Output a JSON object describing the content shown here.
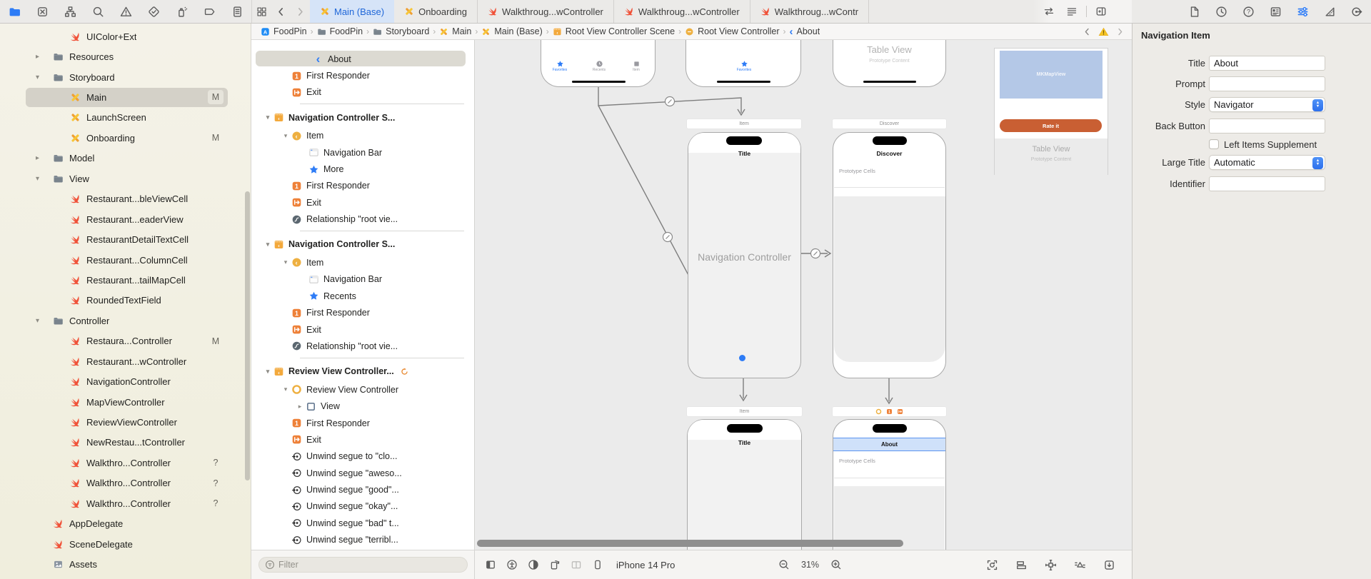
{
  "colors": {
    "accent_blue": "#2e7cf6",
    "selected_tab_bg": "#d6e4f8",
    "swift_orange": "#f05138",
    "storyboard_gold": "#eeb041",
    "scene_orange": "#ee8139",
    "rate_button": "#c95f33",
    "map_blue": "#b4c8e7",
    "nav_selected_blue": "#cfe1fa"
  },
  "toolbar": {
    "navigator_icons": [
      "project-navigator-icon",
      "source-control-icon",
      "symbols-icon",
      "search-icon",
      "issues-icon",
      "tests-icon",
      "debug-icon",
      "breakpoints-icon",
      "reports-icon"
    ],
    "navigator_active_index": 0,
    "tab_overview_icon": "tab-overview-icon",
    "back_label": "back",
    "forward_label": "forward",
    "tabs": [
      {
        "icon": "storyboard",
        "label": "Main (Base)",
        "active": true
      },
      {
        "icon": "storyboard",
        "label": "Onboarding",
        "active": false
      },
      {
        "icon": "swift",
        "label": "Walkthroug...wController",
        "active": false
      },
      {
        "icon": "swift",
        "label": "Walkthroug...wController",
        "active": false
      },
      {
        "icon": "swift",
        "label": "Walkthroug...wContr",
        "active": false
      }
    ],
    "editor_buttons": [
      "code-review-icon",
      "editor-options-icon",
      "add-editor-icon"
    ],
    "inspector_icons": [
      "file-inspector-icon",
      "history-inspector-icon",
      "help-inspector-icon",
      "quick-help-inspector-icon",
      "attributes-inspector-icon",
      "size-inspector-icon",
      "connections-inspector-icon"
    ],
    "inspector_active_index": 4
  },
  "jumpbar": {
    "items": [
      {
        "icon": "appicon",
        "label": "FoodPin"
      },
      {
        "icon": "folder",
        "label": "FoodPin"
      },
      {
        "icon": "folder",
        "label": "Storyboard"
      },
      {
        "icon": "storyboard",
        "label": "Main"
      },
      {
        "icon": "storyboard",
        "label": "Main (Base)"
      },
      {
        "icon": "scene",
        "label": "Root View Controller Scene"
      },
      {
        "icon": "vc-circle",
        "label": "Root View Controller"
      },
      {
        "icon": "back-blue",
        "label": "About"
      }
    ],
    "warning_icon": "warning-icon"
  },
  "sidebar": {
    "items": [
      {
        "indent": 1,
        "icon": "swift",
        "label": "UIColor+Ext"
      },
      {
        "indent": 0,
        "icon": "folder",
        "label": "Resources",
        "disclosure": "closed"
      },
      {
        "indent": 0,
        "icon": "folder",
        "label": "Storyboard",
        "disclosure": "open"
      },
      {
        "indent": 1,
        "icon": "storyboard",
        "label": "Main",
        "badge": "M",
        "selected": true
      },
      {
        "indent": 1,
        "icon": "storyboard",
        "label": "LaunchScreen"
      },
      {
        "indent": 1,
        "icon": "storyboard",
        "label": "Onboarding",
        "badge": "M"
      },
      {
        "indent": 0,
        "icon": "folder",
        "label": "Model",
        "disclosure": "closed"
      },
      {
        "indent": 0,
        "icon": "folder",
        "label": "View",
        "disclosure": "open"
      },
      {
        "indent": 1,
        "icon": "swift",
        "label": "Restaurant...bleViewCell"
      },
      {
        "indent": 1,
        "icon": "swift",
        "label": "Restaurant...eaderView"
      },
      {
        "indent": 1,
        "icon": "swift",
        "label": "RestaurantDetailTextCell"
      },
      {
        "indent": 1,
        "icon": "swift",
        "label": "Restaurant...ColumnCell"
      },
      {
        "indent": 1,
        "icon": "swift",
        "label": "Restaurant...tailMapCell"
      },
      {
        "indent": 1,
        "icon": "swift",
        "label": "RoundedTextField"
      },
      {
        "indent": 0,
        "icon": "folder",
        "label": "Controller",
        "disclosure": "open"
      },
      {
        "indent": 1,
        "icon": "swift",
        "label": "Restaura...Controller",
        "badge": "M"
      },
      {
        "indent": 1,
        "icon": "swift",
        "label": "Restaurant...wController"
      },
      {
        "indent": 1,
        "icon": "swift",
        "label": "NavigationController"
      },
      {
        "indent": 1,
        "icon": "swift",
        "label": "MapViewController"
      },
      {
        "indent": 1,
        "icon": "swift",
        "label": "ReviewViewController"
      },
      {
        "indent": 1,
        "icon": "swift",
        "label": "NewRestau...tController"
      },
      {
        "indent": 1,
        "icon": "swift",
        "label": "Walkthro...Controller",
        "badge": "?"
      },
      {
        "indent": 1,
        "icon": "swift",
        "label": "Walkthro...Controller",
        "badge": "?"
      },
      {
        "indent": 1,
        "icon": "swift",
        "label": "Walkthro...Controller",
        "badge": "?"
      },
      {
        "indent": 0,
        "icon": "swift",
        "label": "AppDelegate"
      },
      {
        "indent": 0,
        "icon": "swift",
        "label": "SceneDelegate"
      },
      {
        "indent": 0,
        "icon": "assets",
        "label": "Assets"
      }
    ]
  },
  "outline": {
    "rows": [
      {
        "type": "row",
        "ind": 71,
        "icon": "back-blue",
        "label": "About",
        "selected": true
      },
      {
        "type": "row",
        "ind": 41,
        "icon": "first-responder",
        "label": "First Responder"
      },
      {
        "type": "row",
        "ind": 41,
        "icon": "exit",
        "label": "Exit"
      },
      {
        "type": "sep"
      },
      {
        "type": "scene",
        "ind": 16,
        "icon": "scene",
        "label": "Navigation Controller S...",
        "disclosure": "open"
      },
      {
        "type": "row",
        "ind": 41,
        "icon": "item-circle",
        "label": "Item",
        "disclosure": "open"
      },
      {
        "type": "row",
        "ind": 65,
        "icon": "navbar",
        "label": "Navigation Bar"
      },
      {
        "type": "row",
        "ind": 65,
        "icon": "star",
        "label": "More"
      },
      {
        "type": "row",
        "ind": 41,
        "icon": "first-responder",
        "label": "First Responder"
      },
      {
        "type": "row",
        "ind": 41,
        "icon": "exit",
        "label": "Exit"
      },
      {
        "type": "row",
        "ind": 41,
        "icon": "relationship",
        "label": "Relationship \"root vie..."
      },
      {
        "type": "sep"
      },
      {
        "type": "scene",
        "ind": 16,
        "icon": "scene",
        "label": "Navigation Controller S...",
        "disclosure": "open"
      },
      {
        "type": "row",
        "ind": 41,
        "icon": "item-circle",
        "label": "Item",
        "disclosure": "open"
      },
      {
        "type": "row",
        "ind": 65,
        "icon": "navbar",
        "label": "Navigation Bar"
      },
      {
        "type": "row",
        "ind": 65,
        "icon": "star",
        "label": "Recents"
      },
      {
        "type": "row",
        "ind": 41,
        "icon": "first-responder",
        "label": "First Responder"
      },
      {
        "type": "row",
        "ind": 41,
        "icon": "exit",
        "label": "Exit"
      },
      {
        "type": "row",
        "ind": 41,
        "icon": "relationship",
        "label": "Relationship \"root vie..."
      },
      {
        "type": "sep"
      },
      {
        "type": "scene",
        "ind": 16,
        "icon": "scene",
        "label": "Review View Controller...",
        "disclosure": "open",
        "badge": "refresh"
      },
      {
        "type": "row",
        "ind": 41,
        "icon": "vc-ring",
        "label": "Review View Controller",
        "disclosure": "open"
      },
      {
        "type": "row",
        "ind": 61,
        "icon": "view-square",
        "label": "View",
        "disclosure": "closed"
      },
      {
        "type": "row",
        "ind": 41,
        "icon": "first-responder",
        "label": "First Responder"
      },
      {
        "type": "row",
        "ind": 41,
        "icon": "exit",
        "label": "Exit"
      },
      {
        "type": "row",
        "ind": 41,
        "icon": "unwind",
        "label": "Unwind segue to \"clo..."
      },
      {
        "type": "row",
        "ind": 41,
        "icon": "unwind",
        "label": "Unwind segue \"aweso..."
      },
      {
        "type": "row",
        "ind": 41,
        "icon": "unwind",
        "label": "Unwind segue \"good\"..."
      },
      {
        "type": "row",
        "ind": 41,
        "icon": "unwind",
        "label": "Unwind segue \"okay\"..."
      },
      {
        "type": "row",
        "ind": 41,
        "icon": "unwind",
        "label": "Unwind segue \"bad\" t..."
      },
      {
        "type": "row",
        "ind": 41,
        "icon": "unwind",
        "label": "Unwind segue \"terribl..."
      }
    ],
    "filter_placeholder": "Filter"
  },
  "canvas": {
    "tabbar_scene_1": {
      "items": [
        {
          "icon": "star",
          "label": "Favorites",
          "active": true
        },
        {
          "icon": "clock",
          "label": "Recents",
          "active": false
        },
        {
          "icon": "square",
          "label": "Item",
          "active": false
        }
      ]
    },
    "tabbar_scene_2": {
      "items": [
        {
          "icon": "star",
          "label": "Favorites",
          "active": true
        }
      ]
    },
    "table_preview_scene": {
      "title": "Table View",
      "subtitle": "Prototype Content"
    },
    "nav_scene": {
      "dock": "Item",
      "status_title": "Title",
      "body_label": "Navigation Controller"
    },
    "discover_scene": {
      "dock": "Discover",
      "title": "Discover",
      "cells": "Prototype Cells"
    },
    "review_scene": {
      "map_label": "MKMapView",
      "button_label": "Rate it",
      "table_title": "Table View",
      "table_subtitle": "Prototype Content"
    },
    "item_scene": {
      "dock": "Item",
      "status_title": "Title"
    },
    "about_scene": {
      "title": "About",
      "cells": "Prototype Cells"
    }
  },
  "bottombar": {
    "view_icons": [
      "outline-toggle-icon",
      "accessibility-icon",
      "appearance-icon",
      "orientation-icon",
      "split-view-icon",
      "device-icon"
    ],
    "device_name": "iPhone 14 Pro",
    "zoom_out_icon": "zoom-out-icon",
    "zoom_level": "31%",
    "zoom_in_icon": "zoom-in-icon",
    "layout_icons": [
      "update-frames-icon",
      "align-icon",
      "add-constraints-icon",
      "resolve-layout-icon",
      "embed-icon"
    ]
  },
  "inspector": {
    "title": "Navigation Item",
    "fields": [
      {
        "label": "Title",
        "type": "text",
        "value": "About"
      },
      {
        "label": "Prompt",
        "type": "text",
        "value": ""
      },
      {
        "label": "Style",
        "type": "popup",
        "value": "Navigator"
      },
      {
        "label": "Back Button",
        "type": "text",
        "value": ""
      },
      {
        "label": "",
        "type": "checkbox",
        "checked": false,
        "text": "Left Items Supplement"
      },
      {
        "label": "Large Title",
        "type": "popup",
        "value": "Automatic"
      },
      {
        "label": "Identifier",
        "type": "text",
        "value": ""
      }
    ]
  }
}
